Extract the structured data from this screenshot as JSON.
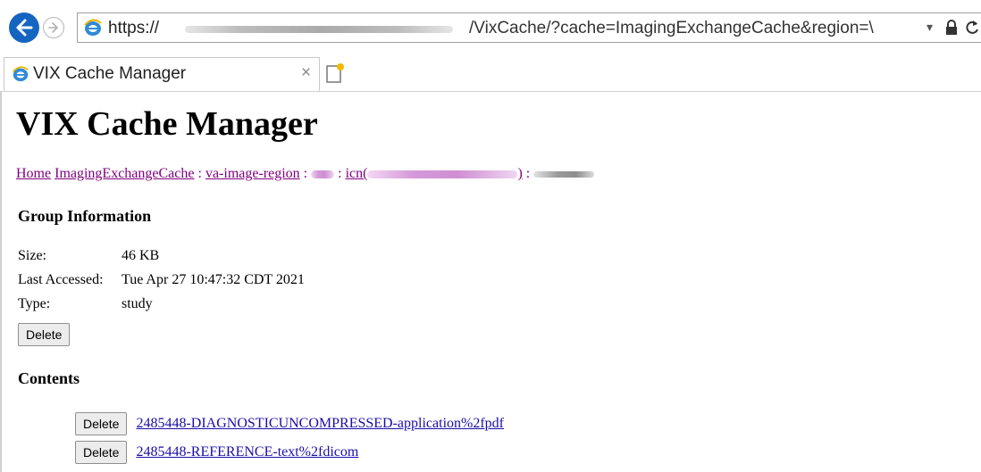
{
  "browser": {
    "url_scheme": "https://",
    "url_rest": "/VixCache/?cache=ImagingExchangeCache&region=\\",
    "url_dropdown": "▾",
    "tab_title": "VIX Cache Manager",
    "tab_close": "×"
  },
  "page": {
    "title": "VIX Cache Manager",
    "breadcrumb": {
      "home": "Home",
      "cache": "ImagingExchangeCache",
      "region": "va-image-region",
      "icn_prefix": "icn(",
      "icn_suffix": ")",
      "separator": " : "
    },
    "group_info": {
      "heading": "Group Information",
      "rows": [
        {
          "label": "Size:",
          "value": "46 KB"
        },
        {
          "label": "Last Accessed:",
          "value": "Tue Apr 27 10:47:32 CDT 2021"
        },
        {
          "label": "Type:",
          "value": "study"
        }
      ],
      "delete_label": "Delete"
    },
    "contents": {
      "heading": "Contents",
      "items": [
        {
          "delete_label": "Delete",
          "link": "2485448-DIAGNOSTICUNCOMPRESSED-application%2fpdf"
        },
        {
          "delete_label": "Delete",
          "link": "2485448-REFERENCE-text%2fdicom"
        }
      ]
    }
  },
  "colors": {
    "visited_link": "#800080",
    "link": "#1a0dab",
    "back_button": "#1565c0"
  }
}
